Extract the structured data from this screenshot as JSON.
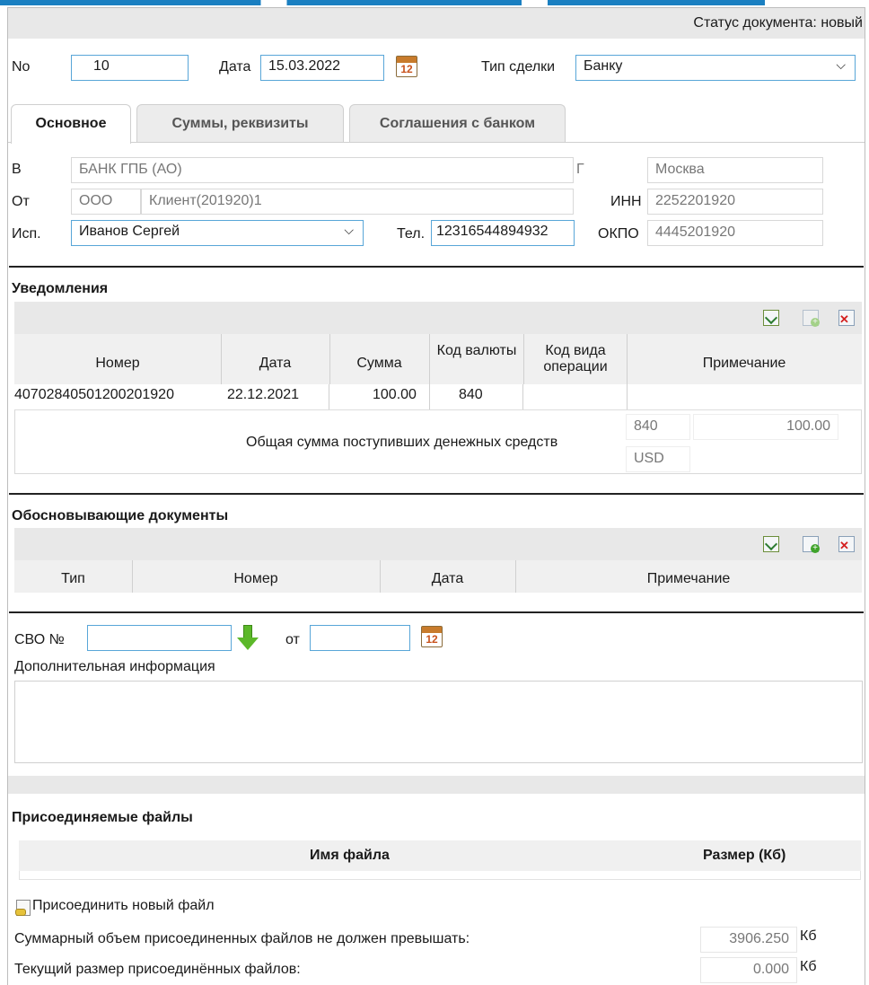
{
  "header": {
    "status_text": "Статус документа: новый"
  },
  "doc": {
    "no_label": "No",
    "no_value": "10",
    "date_label": "Дата",
    "date_value": "15.03.2022",
    "deal_label": "Тип сделки",
    "deal_value": "Банку"
  },
  "calendar_day": "12",
  "tabs": [
    {
      "label": "Основное"
    },
    {
      "label": "Суммы, реквизиты"
    },
    {
      "label": "Соглашения с банком"
    }
  ],
  "bank": {
    "v_label": "В",
    "v_value": "БАНК ГПБ (АО)",
    "g_label": "Г",
    "g_value": "Москва",
    "ot_label": "От",
    "ot_org": "ООО",
    "ot_name": "Клиент(201920)1",
    "inn_label": "ИНН",
    "inn_value": "2252201920",
    "isp_label": "Исп.",
    "isp_value": "Иванов Сергей",
    "tel_label": "Тел.",
    "tel_value": "12316544894932",
    "okpo_label": "ОКПО",
    "okpo_value": "4445201920"
  },
  "notifications": {
    "title": "Уведомления",
    "columns": [
      "Номер",
      "Дата",
      "Сумма",
      "Код валюты",
      "Код вида операции",
      "Примечание"
    ],
    "row": {
      "number": "40702840501200201920",
      "date": "22.12.2021",
      "sum": "100.00",
      "currency": "840"
    },
    "total_label": "Общая сумма поступивших денежных средств",
    "total_code": "840",
    "total_sum": "100.00",
    "total_currency": "USD"
  },
  "basis_docs": {
    "title": "Обосновывающие документы",
    "columns": [
      "Тип",
      "Номер",
      "Дата",
      "Примечание"
    ]
  },
  "svo": {
    "label": "СВО №",
    "value": "",
    "from_label": "от",
    "from_value": ""
  },
  "additional": {
    "label": "Дополнительная информация",
    "value": ""
  },
  "files": {
    "title": "Присоединяемые файлы",
    "col_name": "Имя файла",
    "col_size": "Размер (Кб)",
    "attach_link": "Присоединить новый файл",
    "max_label": "Суммарный объем присоединенных файлов не должен превышать:",
    "max_value": "3906.250",
    "current_label": "Текущий размер присоединённых файлов:",
    "current_value": "0.000",
    "unit": "Кб"
  },
  "colors": {
    "accent_border": "#58a6d8",
    "header_grey": "#e8e8e8",
    "title_blue": "#1a7fc1"
  }
}
